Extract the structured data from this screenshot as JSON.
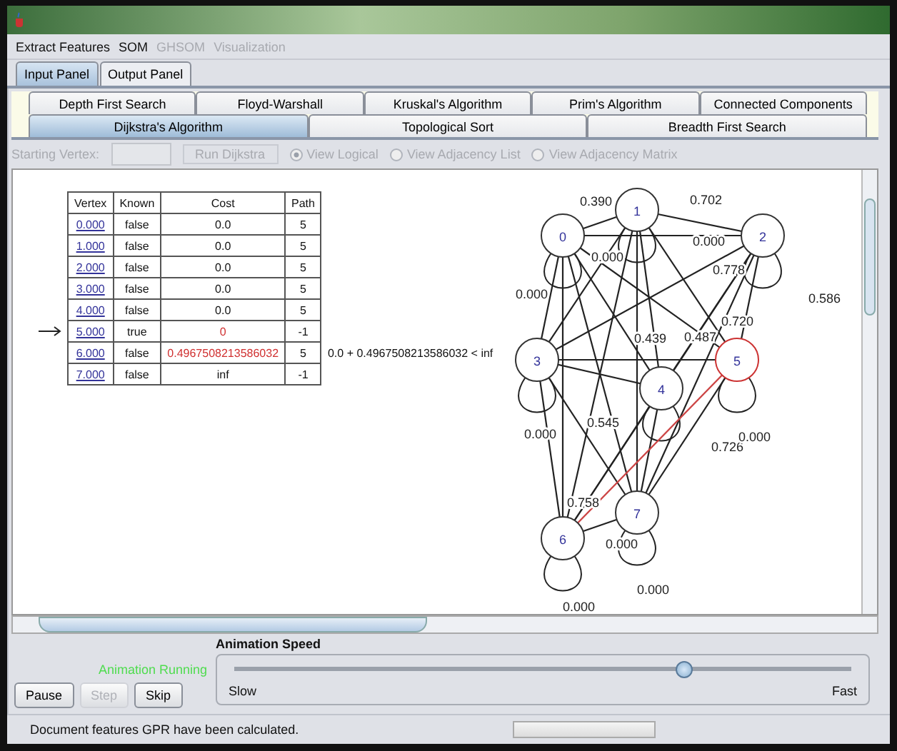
{
  "menu": [
    {
      "label": "Extract Features",
      "disabled": false
    },
    {
      "label": "SOM",
      "disabled": false
    },
    {
      "label": "GHSOM",
      "disabled": true
    },
    {
      "label": "Visualization",
      "disabled": true
    }
  ],
  "panel_tabs": [
    {
      "label": "Input Panel",
      "selected": true
    },
    {
      "label": "Output Panel",
      "selected": false
    }
  ],
  "algorithm_tabs": [
    [
      {
        "label": "Depth First Search",
        "selected": false
      },
      {
        "label": "Floyd-Warshall",
        "selected": false
      },
      {
        "label": "Kruskal's Algorithm",
        "selected": false
      },
      {
        "label": "Prim's Algorithm",
        "selected": false
      },
      {
        "label": "Connected Components",
        "selected": false
      }
    ],
    [
      {
        "label": "Dijkstra's Algorithm",
        "selected": true
      },
      {
        "label": "Topological Sort",
        "selected": false
      },
      {
        "label": "Breadth First Search",
        "selected": false
      }
    ]
  ],
  "toolbar": {
    "starting_vertex_label": "Starting Vertex:",
    "run_button": "Run Dijkstra",
    "disabled": true,
    "views": [
      {
        "label": "View Logical",
        "selected": true
      },
      {
        "label": "View Adjacency List",
        "selected": false
      },
      {
        "label": "View Adjacency Matrix",
        "selected": false
      }
    ]
  },
  "table": {
    "columns": [
      "Vertex",
      "Known",
      "Cost",
      "Path"
    ],
    "rows": [
      {
        "vertex": "0.000",
        "known": "false",
        "cost": "0.0",
        "path": "5",
        "highlight": false,
        "current": false
      },
      {
        "vertex": "1.000",
        "known": "false",
        "cost": "0.0",
        "path": "5",
        "highlight": false,
        "current": false
      },
      {
        "vertex": "2.000",
        "known": "false",
        "cost": "0.0",
        "path": "5",
        "highlight": false,
        "current": false
      },
      {
        "vertex": "3.000",
        "known": "false",
        "cost": "0.0",
        "path": "5",
        "highlight": false,
        "current": false
      },
      {
        "vertex": "4.000",
        "known": "false",
        "cost": "0.0",
        "path": "5",
        "highlight": false,
        "current": false
      },
      {
        "vertex": "5.000",
        "known": "true",
        "cost": "0",
        "path": "-1",
        "highlight": true,
        "current": true
      },
      {
        "vertex": "6.000",
        "known": "false",
        "cost": "0.4967508213586032",
        "path": "5",
        "highlight": true,
        "current": false,
        "note": "0.0 + 0.4967508213586032 < inf"
      },
      {
        "vertex": "7.000",
        "known": "false",
        "cost": "inf",
        "path": "-1",
        "highlight": false,
        "current": false
      }
    ]
  },
  "graph": {
    "nodes": [
      {
        "label": "0",
        "highlight": false
      },
      {
        "label": "1",
        "highlight": false
      },
      {
        "label": "2",
        "highlight": false
      },
      {
        "label": "3",
        "highlight": false
      },
      {
        "label": "4",
        "highlight": false
      },
      {
        "label": "5",
        "highlight": true
      },
      {
        "label": "6",
        "highlight": false
      },
      {
        "label": "7",
        "highlight": false
      }
    ],
    "edge_labels": [
      "0.390",
      "0.702",
      "0.000",
      "0.000",
      "0.778",
      "0.000",
      "0.586",
      "0.720",
      "0.439",
      "0.487",
      "0.545",
      "0.000",
      "0.726",
      "0.000",
      "0.758",
      "0.000",
      "0.000",
      "0.000"
    ]
  },
  "controls": {
    "buttons": [
      {
        "label": "Pause",
        "disabled": false
      },
      {
        "label": "Step",
        "disabled": true
      },
      {
        "label": "Skip",
        "disabled": false
      }
    ],
    "status": "Animation Running",
    "speed_title": "Animation Speed",
    "speed": {
      "level": 0.73
    },
    "min_label": "Slow",
    "max_label": "Fast"
  },
  "status_bar": "Document features GPR have been calculated.",
  "progress": {
    "level": 0
  }
}
